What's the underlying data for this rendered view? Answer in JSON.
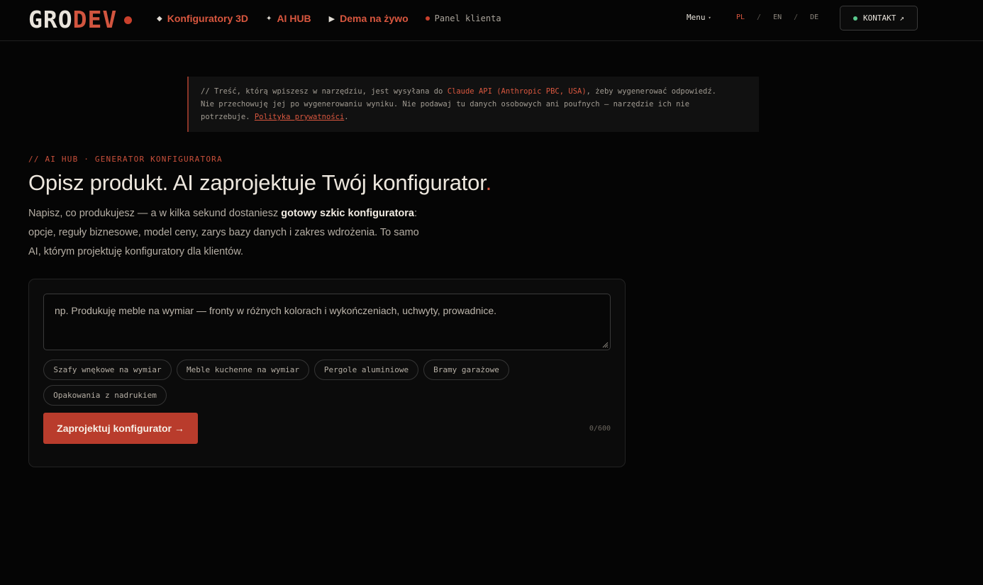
{
  "header": {
    "logo_part1": "GRO",
    "logo_part2": "DEV",
    "nav": [
      {
        "icon": "diamond-icon",
        "glyph": "◆",
        "label": "Konfiguratory 3D"
      },
      {
        "icon": "sparkle-icon",
        "glyph": "✦",
        "label": "AI HUB"
      },
      {
        "icon": "play-icon",
        "glyph": "▶",
        "label": "Dema na żywo"
      }
    ],
    "panel_label": "Panel klienta",
    "menu_label": "Menu",
    "languages": [
      "PL",
      "EN",
      "DE"
    ],
    "active_language": "PL",
    "contact_label": "KONTAKT",
    "contact_arrow": "↗"
  },
  "notice": {
    "part1": "// Treść, którą wpiszesz w narzędziu, jest wysyłana do ",
    "highlight": "Claude API (Anthropic PBC, USA)",
    "part2": ", żeby wygenerować odpowiedź.",
    "line2": "Nie przechowuję jej po wygenerowaniu wyniku. Nie podawaj tu danych osobowych ani poufnych — narzędzie ich nie",
    "line3_prefix": "potrzebuje. ",
    "link": "Polityka prywatności",
    "line3_suffix": "."
  },
  "hero": {
    "eyebrow": "// AI HUB · GENERATOR KONFIGURATORA",
    "title": "Opisz produkt. AI zaprojektuje Twój konfigurator",
    "title_period": ".",
    "lead_part1": "Napisz, co produkujesz — a w kilka sekund dostaniesz ",
    "lead_strong": "gotowy szkic konfiguratora",
    "lead_part2": ":",
    "lead_line2": "opcje, reguły biznesowe, model ceny, zarys bazy danych i zakres wdrożenia. To samo",
    "lead_line3": "AI, którym projektuję konfiguratory dla klientów."
  },
  "form": {
    "placeholder": "np. Produkuję meble na wymiar — fronty w różnych kolorach i wykończeniach, uchwyty, prowadnice.",
    "chips": [
      "Szafy wnękowe na wymiar",
      "Meble kuchenne na wymiar",
      "Pergole aluminiowe",
      "Bramy garażowe",
      "Opakowania z nadrukiem"
    ],
    "submit_label": "Zaprojektuj konfigurator →",
    "counter": "0/600"
  },
  "colors": {
    "accent": "#d9573f",
    "button": "#b93c2c",
    "background": "#050505",
    "status_dot": "#5ac98d"
  }
}
